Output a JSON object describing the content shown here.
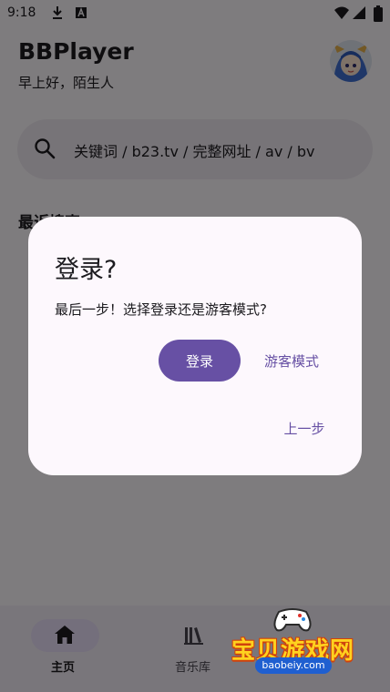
{
  "status_bar": {
    "time": "9:18"
  },
  "header": {
    "title": "BBPlayer",
    "greeting": "早上好，陌生人"
  },
  "search": {
    "placeholder": "关键词 / b23.tv / 完整网址 / av / bv"
  },
  "recent": {
    "heading": "最近搜索"
  },
  "dialog": {
    "title": "登录?",
    "message": "最后一步！选择登录还是游客模式?",
    "login_label": "登录",
    "guest_label": "游客模式",
    "back_label": "上一步"
  },
  "bottom_nav": {
    "items": [
      {
        "label": "主页",
        "icon": "home-icon",
        "selected": true
      },
      {
        "label": "音乐库",
        "icon": "library-icon",
        "selected": false
      }
    ]
  },
  "watermark": {
    "text": "宝贝游戏网",
    "url": "baobeiy.com"
  },
  "colors": {
    "primary": "#6750a4",
    "surface": "#fdf8fd",
    "search_bg": "#efe8f1",
    "nav_pill": "#e8def8",
    "scrim": "rgba(0,0,0,0.5)"
  }
}
